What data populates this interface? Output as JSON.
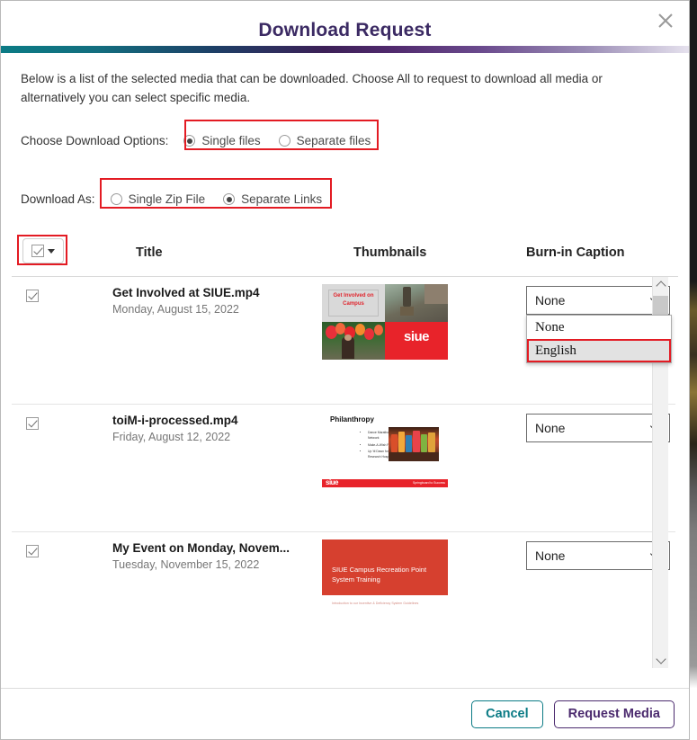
{
  "dialog": {
    "title": "Download Request",
    "close_icon": "close-icon",
    "intro": "Below is a list of the selected media that can be downloaded. Choose All to request to download all media or alternatively you can select specific media.",
    "accent_teal": "#0b7b85",
    "accent_purple": "#4b2a6e",
    "highlight_red": "#e31b23"
  },
  "download_options": {
    "label": "Choose Download Options:",
    "options": [
      {
        "label": "Single files",
        "selected": true
      },
      {
        "label": "Separate files",
        "selected": false
      }
    ]
  },
  "download_as": {
    "label": "Download As:",
    "options": [
      {
        "label": "Single Zip File",
        "selected": false
      },
      {
        "label": "Separate Links",
        "selected": true
      }
    ]
  },
  "table": {
    "select_all": {
      "checked": true,
      "caret_icon": "chevron-down-icon"
    },
    "headers": {
      "title": "Title",
      "thumbnails": "Thumbnails",
      "caption": "Burn-in Caption"
    },
    "rows": [
      {
        "checked": true,
        "title": "Get Involved at SIUE.mp4",
        "date": "Monday, August 15, 2022",
        "thumbnail": {
          "kind": "collage",
          "headline": "Get Involved on Campus",
          "logo": "siue"
        },
        "caption_value": "None",
        "caption_open": true,
        "caption_options": [
          {
            "label": "None",
            "highlighted": false
          },
          {
            "label": "English",
            "highlighted": true
          }
        ]
      },
      {
        "checked": true,
        "title": "toiM-i-processed.mp4",
        "date": "Friday, August 12, 2022",
        "thumbnail": {
          "kind": "slide-philanthropy",
          "headline": "Philanthropy",
          "bullets": [
            "Dance Marathon for Children's Miracle Network",
            "Make-A-Wish Foundation",
            "Up 'til Dawn for St. Jude Children's Research Hospital"
          ],
          "logo": "siue",
          "tagline": "Springboard to Success"
        },
        "caption_value": "None",
        "caption_open": false,
        "caption_options": []
      },
      {
        "checked": true,
        "title": "My Event on Monday, Novem...",
        "date": "Tuesday, November 15, 2022",
        "thumbnail": {
          "kind": "slide-red-title",
          "headline": "SIUE Campus Recreation Point System Training",
          "subtitle": "Introduction to our Incentive & Deficiency System Guidelines"
        },
        "caption_value": "None",
        "caption_open": false,
        "caption_options": []
      }
    ]
  },
  "scrollbar": {
    "up_icon": "chevron-up-icon",
    "down_icon": "chevron-down-icon"
  },
  "footer": {
    "cancel_label": "Cancel",
    "request_label": "Request Media"
  }
}
